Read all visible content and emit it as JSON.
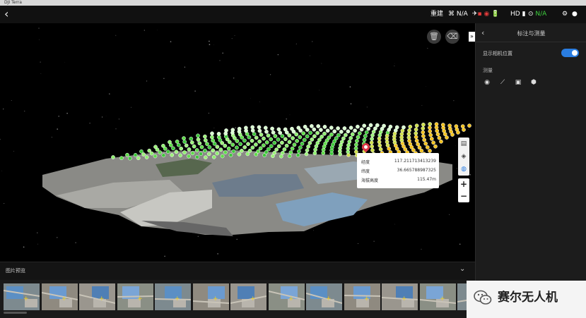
{
  "window": {
    "title": "DJI Terra"
  },
  "topbar": {
    "rebuild_label": "重建",
    "status_items": [
      {
        "name": "rtk",
        "text": "N/A"
      },
      {
        "name": "signal",
        "text": "HD"
      },
      {
        "name": "gps",
        "text": "N/A"
      }
    ]
  },
  "panel": {
    "title": "标注与测量",
    "show_camera_label": "显示相机位置",
    "show_camera_on": true,
    "measure_section": "测量",
    "tools": [
      "point-measure-icon",
      "line-measure-icon",
      "area-measure-icon",
      "volume-measure-icon"
    ]
  },
  "popup": {
    "rows": [
      {
        "label": "经度",
        "value": "117.211713413239"
      },
      {
        "label": "纬度",
        "value": "36.665788987325"
      },
      {
        "label": "海拔高度",
        "value": "115.47m"
      }
    ]
  },
  "preview": {
    "title": "图片预览",
    "thumb_count": 13
  },
  "watermark": {
    "text": "赛尔无人机"
  },
  "colors": {
    "accent": "#2a7de1",
    "pin": "#d93846",
    "ok": "#3fd13f"
  }
}
